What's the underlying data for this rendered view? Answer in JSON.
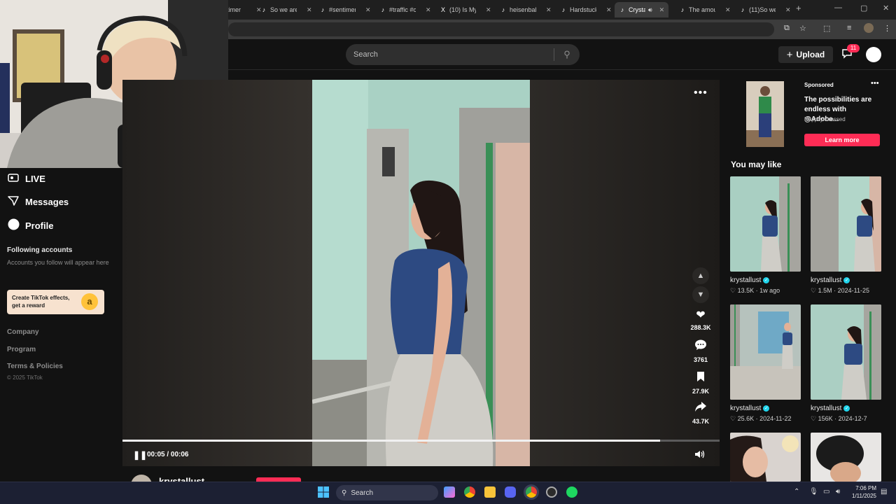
{
  "browser": {
    "tabs": [
      {
        "icon": "tiktok-icon",
        "title": "timer"
      },
      {
        "icon": "tiktok-icon",
        "title": "So we are"
      },
      {
        "icon": "tiktok-icon",
        "title": "#sentimen"
      },
      {
        "icon": "tiktok-icon",
        "title": "#traffic #c"
      },
      {
        "icon": "x-icon",
        "title": "(10) Is My"
      },
      {
        "icon": "tiktok-icon",
        "title": "heisenbalk"
      },
      {
        "icon": "tiktok-icon",
        "title": "Hardstuck"
      },
      {
        "icon": "tiktok-icon",
        "title": "Crysta",
        "active": true
      },
      {
        "icon": "tiktok-icon",
        "title": "The amou"
      },
      {
        "icon": "tiktok-icon",
        "title": "(11)So we"
      }
    ],
    "new_tab": "+"
  },
  "header": {
    "search_placeholder": "Search",
    "upload_label": "Upload",
    "inbox_count": "11"
  },
  "sidebar": {
    "nav": [
      {
        "icon": "live-icon",
        "label": "LIVE"
      },
      {
        "icon": "messages-icon",
        "label": "Messages"
      },
      {
        "icon": "profile-icon",
        "label": "Profile"
      }
    ],
    "following_heading": "Following accounts",
    "following_text": "Accounts you follow will appear here",
    "effects_card": "Create TikTok effects, get a reward",
    "footer_links": [
      "Company",
      "Program",
      "Terms & Policies"
    ],
    "copyright": "© 2025 TikTok"
  },
  "player": {
    "likes": "288.3K",
    "comments": "3761",
    "saves": "27.9K",
    "shares": "43.7K",
    "time": "00:05 / 00:06",
    "progress": 0.9,
    "author": "krystallust"
  },
  "right_rail": {
    "ad": {
      "sponsored": "Sponsored",
      "title": "The possibilities are endless with @Adobe...",
      "brand": "Happily Dressed",
      "cta": "Learn more"
    },
    "you_may_like": "You may like",
    "recommendations": [
      {
        "author": "krystallust",
        "likes": "13.5K",
        "date": "1w ago"
      },
      {
        "author": "krystallust",
        "likes": "1.5M",
        "date": "2024-11-25"
      },
      {
        "author": "krystallust",
        "likes": "25.6K",
        "date": "2024-11-22"
      },
      {
        "author": "krystallust",
        "likes": "156K",
        "date": "2024-12-7"
      },
      {
        "author": "",
        "likes": "",
        "date": ""
      },
      {
        "author": "",
        "likes": "",
        "date": ""
      }
    ]
  },
  "taskbar": {
    "search_label": "Search",
    "time": "7:06 PM",
    "date": "1/11/2025"
  }
}
